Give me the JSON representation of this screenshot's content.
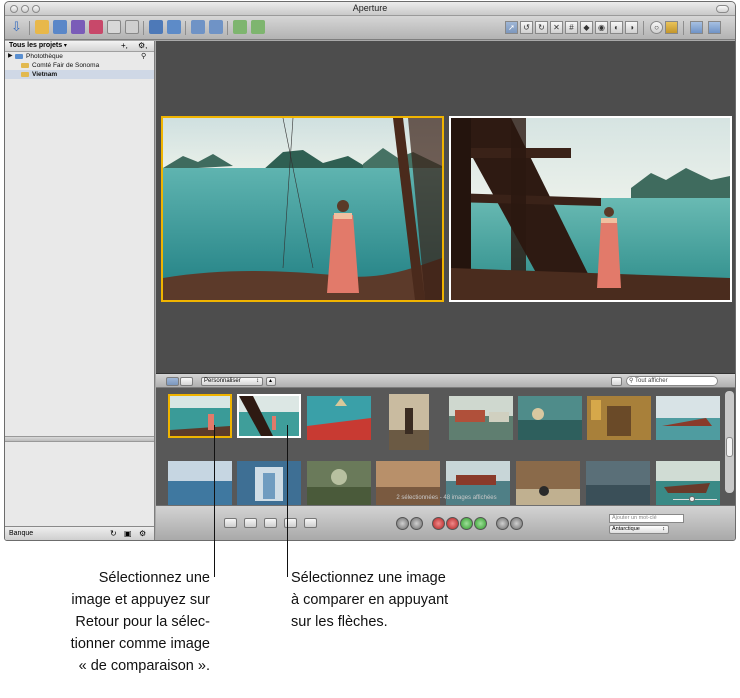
{
  "window": {
    "title": "Aperture"
  },
  "projects": {
    "header": "Tous les projets",
    "add_label": "+,",
    "action_label": "⚙,",
    "items": [
      {
        "label": "Photothèque"
      },
      {
        "label": "Comté Fair de Sonoma"
      },
      {
        "label": "Vietnam"
      }
    ]
  },
  "lower_panel": {
    "label": "Banque"
  },
  "browser": {
    "view_popup": "Personnaliser",
    "search_placeholder": "Tout afficher",
    "status": "2 sélectionnées - 48 images affichées"
  },
  "keywords": {
    "input_placeholder": "Ajouter un mot-clé",
    "preset_value": "Antarctique"
  },
  "colors": {
    "primary_selection": "#f0b400",
    "secondary_selection": "#ffffff",
    "viewer_bg": "#4d4d4d"
  },
  "annotations": {
    "left": [
      "Sélectionnez une",
      "image et appuyez sur",
      "Retour pour la sélec-",
      "tionner comme image",
      "« de comparaison »."
    ],
    "right": [
      "Sélectionnez une image",
      "à comparer en appuyant",
      "sur les flèches."
    ]
  }
}
